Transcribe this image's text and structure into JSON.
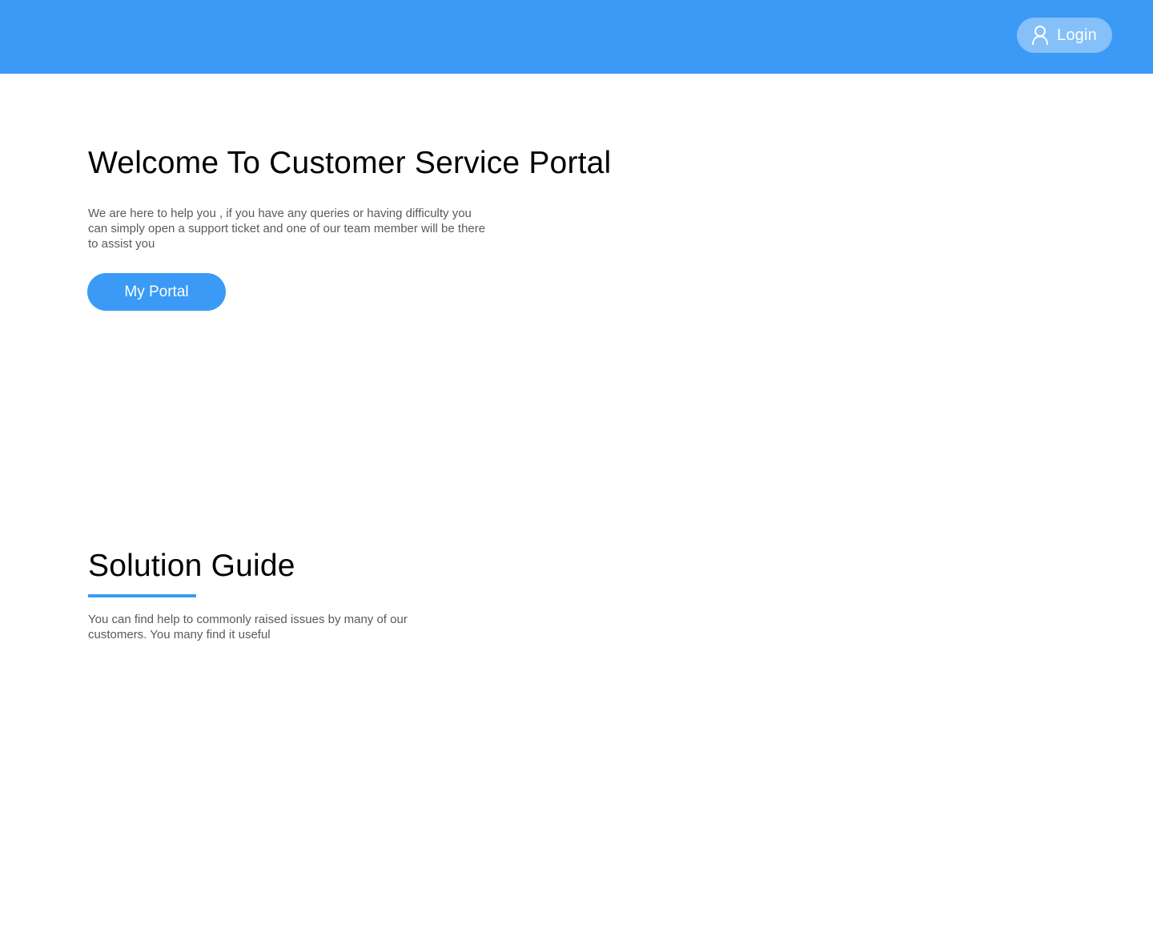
{
  "header": {
    "login_label": "Login",
    "login_icon": "user-icon",
    "background_color": "#3a9af6"
  },
  "hero": {
    "title": "Welcome To Customer Service Portal",
    "description": "We are here to help you  , if you have any queries or having difficulty you can simply open a support ticket and one of our team member will be there to assist you",
    "portal_button_label": "My Portal"
  },
  "solution_guide": {
    "title": "Solution Guide",
    "description": "You can find help to commonly raised issues by many of our customers. You many find it useful"
  },
  "colors": {
    "accent": "#3a9af6",
    "body_text": "#5a5a5a",
    "heading_text": "#000000"
  }
}
